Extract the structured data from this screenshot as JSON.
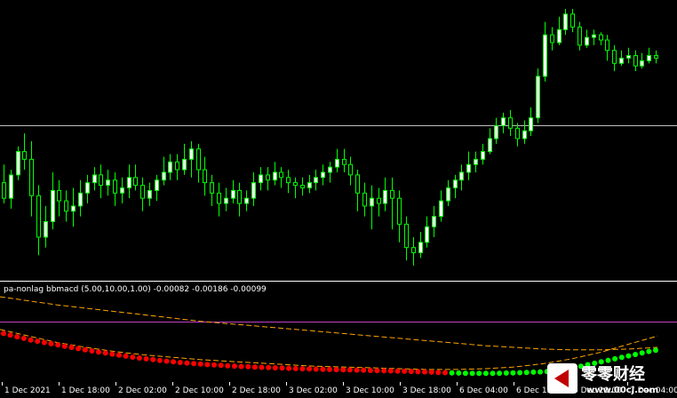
{
  "indicator": {
    "title": "pa-nonlag bbmacd (5.00,10.00,1.00) -0.00082 -0.00186 -0.00099"
  },
  "watermark": {
    "text": "零零财经",
    "url": "www.00cj.com"
  },
  "colors": {
    "background": "#000000",
    "candle_up": "#ffffff",
    "candle_down": "#000000",
    "candle_outline": "#00ff00",
    "hline": "#c0c0c0",
    "separator": "#ffffff",
    "zero_line": "#c040c0",
    "band": "#ffa500",
    "macd_down": "#ff0000",
    "macd_up": "#00ff00"
  },
  "chart_data": [
    {
      "type": "candlestick",
      "horizontal_line": 0.55,
      "ylim": [
        0,
        1
      ],
      "candles": [
        [
          0.33,
          0.27,
          0.4,
          0.25
        ],
        [
          0.27,
          0.36,
          0.38,
          0.23
        ],
        [
          0.36,
          0.45,
          0.47,
          0.34
        ],
        [
          0.45,
          0.42,
          0.52,
          0.38
        ],
        [
          0.42,
          0.28,
          0.49,
          0.2
        ],
        [
          0.28,
          0.12,
          0.32,
          0.05
        ],
        [
          0.12,
          0.18,
          0.24,
          0.08
        ],
        [
          0.18,
          0.3,
          0.37,
          0.15
        ],
        [
          0.3,
          0.26,
          0.34,
          0.2
        ],
        [
          0.26,
          0.22,
          0.3,
          0.18
        ],
        [
          0.22,
          0.24,
          0.31,
          0.16
        ],
        [
          0.24,
          0.29,
          0.34,
          0.2
        ],
        [
          0.29,
          0.33,
          0.36,
          0.25
        ],
        [
          0.33,
          0.36,
          0.39,
          0.3
        ],
        [
          0.36,
          0.32,
          0.4,
          0.27
        ],
        [
          0.32,
          0.34,
          0.38,
          0.28
        ],
        [
          0.34,
          0.29,
          0.37,
          0.24
        ],
        [
          0.29,
          0.31,
          0.35,
          0.25
        ],
        [
          0.31,
          0.35,
          0.4,
          0.27
        ],
        [
          0.35,
          0.32,
          0.4,
          0.3
        ],
        [
          0.32,
          0.27,
          0.35,
          0.22
        ],
        [
          0.27,
          0.3,
          0.33,
          0.24
        ],
        [
          0.3,
          0.34,
          0.36,
          0.26
        ],
        [
          0.34,
          0.37,
          0.43,
          0.32
        ],
        [
          0.37,
          0.41,
          0.44,
          0.34
        ],
        [
          0.41,
          0.38,
          0.44,
          0.34
        ],
        [
          0.38,
          0.42,
          0.48,
          0.36
        ],
        [
          0.42,
          0.46,
          0.49,
          0.35
        ],
        [
          0.46,
          0.38,
          0.48,
          0.33
        ],
        [
          0.38,
          0.33,
          0.43,
          0.28
        ],
        [
          0.33,
          0.29,
          0.36,
          0.24
        ],
        [
          0.29,
          0.25,
          0.33,
          0.2
        ],
        [
          0.25,
          0.27,
          0.31,
          0.22
        ],
        [
          0.27,
          0.3,
          0.34,
          0.25
        ],
        [
          0.3,
          0.25,
          0.33,
          0.2
        ],
        [
          0.25,
          0.27,
          0.3,
          0.22
        ],
        [
          0.27,
          0.33,
          0.37,
          0.24
        ],
        [
          0.33,
          0.36,
          0.39,
          0.3
        ],
        [
          0.36,
          0.34,
          0.39,
          0.3
        ],
        [
          0.34,
          0.37,
          0.41,
          0.32
        ],
        [
          0.37,
          0.35,
          0.39,
          0.31
        ],
        [
          0.35,
          0.33,
          0.38,
          0.29
        ],
        [
          0.33,
          0.32,
          0.35,
          0.27
        ],
        [
          0.32,
          0.31,
          0.35,
          0.28
        ],
        [
          0.31,
          0.33,
          0.36,
          0.29
        ],
        [
          0.33,
          0.35,
          0.38,
          0.3
        ],
        [
          0.35,
          0.37,
          0.4,
          0.32
        ],
        [
          0.37,
          0.39,
          0.41,
          0.33
        ],
        [
          0.39,
          0.42,
          0.46,
          0.37
        ],
        [
          0.42,
          0.4,
          0.46,
          0.37
        ],
        [
          0.4,
          0.36,
          0.43,
          0.32
        ],
        [
          0.36,
          0.29,
          0.38,
          0.22
        ],
        [
          0.29,
          0.24,
          0.33,
          0.2
        ],
        [
          0.24,
          0.27,
          0.32,
          0.15
        ],
        [
          0.27,
          0.25,
          0.31,
          0.2
        ],
        [
          0.25,
          0.3,
          0.35,
          0.22
        ],
        [
          0.3,
          0.27,
          0.35,
          0.15
        ],
        [
          0.27,
          0.17,
          0.3,
          0.1
        ],
        [
          0.17,
          0.08,
          0.2,
          0.03
        ],
        [
          0.08,
          0.06,
          0.12,
          0.01
        ],
        [
          0.06,
          0.1,
          0.14,
          0.04
        ],
        [
          0.1,
          0.16,
          0.2,
          0.08
        ],
        [
          0.16,
          0.2,
          0.24,
          0.12
        ],
        [
          0.2,
          0.26,
          0.3,
          0.18
        ],
        [
          0.26,
          0.31,
          0.34,
          0.24
        ],
        [
          0.31,
          0.34,
          0.36,
          0.27
        ],
        [
          0.34,
          0.37,
          0.4,
          0.3
        ],
        [
          0.37,
          0.4,
          0.45,
          0.34
        ],
        [
          0.4,
          0.42,
          0.45,
          0.37
        ],
        [
          0.42,
          0.45,
          0.48,
          0.4
        ],
        [
          0.45,
          0.5,
          0.54,
          0.44
        ],
        [
          0.5,
          0.55,
          0.58,
          0.48
        ],
        [
          0.55,
          0.58,
          0.6,
          0.52
        ],
        [
          0.58,
          0.54,
          0.61,
          0.51
        ],
        [
          0.54,
          0.5,
          0.56,
          0.47
        ],
        [
          0.5,
          0.53,
          0.57,
          0.48
        ],
        [
          0.53,
          0.58,
          0.62,
          0.51
        ],
        [
          0.58,
          0.74,
          0.77,
          0.56
        ],
        [
          0.74,
          0.9,
          0.95,
          0.72
        ],
        [
          0.9,
          0.87,
          0.93,
          0.84
        ],
        [
          0.87,
          0.92,
          0.97,
          0.86
        ],
        [
          0.92,
          0.98,
          1.0,
          0.9
        ],
        [
          0.98,
          0.93,
          1.0,
          0.91
        ],
        [
          0.93,
          0.86,
          0.95,
          0.84
        ],
        [
          0.86,
          0.89,
          0.92,
          0.85
        ],
        [
          0.89,
          0.9,
          0.92,
          0.86
        ],
        [
          0.9,
          0.88,
          0.91,
          0.86
        ],
        [
          0.88,
          0.84,
          0.9,
          0.8
        ],
        [
          0.84,
          0.79,
          0.86,
          0.76
        ],
        [
          0.79,
          0.81,
          0.84,
          0.78
        ],
        [
          0.81,
          0.82,
          0.85,
          0.79
        ],
        [
          0.82,
          0.78,
          0.84,
          0.76
        ],
        [
          0.78,
          0.8,
          0.83,
          0.77
        ],
        [
          0.8,
          0.82,
          0.85,
          0.79
        ],
        [
          0.82,
          0.81,
          0.84,
          0.79
        ]
      ]
    },
    {
      "type": "line",
      "zero_line": 0.7,
      "ylim": [
        0,
        1
      ],
      "upper_band": [
        1.0,
        0.95,
        0.9,
        0.86,
        0.82,
        0.78,
        0.74,
        0.7,
        0.67,
        0.64,
        0.61,
        0.58,
        0.55,
        0.52,
        0.49,
        0.46,
        0.43,
        0.4,
        0.38,
        0.36,
        0.35,
        0.35,
        0.36,
        0.38
      ],
      "lower_band": [
        0.6,
        0.52,
        0.44,
        0.38,
        0.33,
        0.29,
        0.26,
        0.23,
        0.21,
        0.19,
        0.17,
        0.15,
        0.14,
        0.13,
        0.12,
        0.11,
        0.11,
        0.12,
        0.14,
        0.18,
        0.24,
        0.32,
        0.42,
        0.52
      ],
      "macd": [
        0.55,
        0.53,
        0.51,
        0.49,
        0.47,
        0.455,
        0.44,
        0.425,
        0.41,
        0.395,
        0.38,
        0.365,
        0.35,
        0.337,
        0.324,
        0.311,
        0.298,
        0.285,
        0.273,
        0.261,
        0.25,
        0.24,
        0.23,
        0.221,
        0.212,
        0.204,
        0.196,
        0.189,
        0.182,
        0.176,
        0.17,
        0.165,
        0.16,
        0.155,
        0.151,
        0.147,
        0.143,
        0.139,
        0.136,
        0.133,
        0.13,
        0.127,
        0.124,
        0.121,
        0.118,
        0.116,
        0.114,
        0.112,
        0.11,
        0.108,
        0.106,
        0.104,
        0.102,
        0.1,
        0.098,
        0.096,
        0.094,
        0.092,
        0.09,
        0.088,
        0.086,
        0.083,
        0.08,
        0.077,
        0.074,
        0.071,
        0.068,
        0.066,
        0.064,
        0.063,
        0.062,
        0.062,
        0.063,
        0.064,
        0.066,
        0.068,
        0.071,
        0.074,
        0.077,
        0.08,
        0.084,
        0.09,
        0.1,
        0.115,
        0.132,
        0.15,
        0.168,
        0.186,
        0.204,
        0.222,
        0.24,
        0.258,
        0.276,
        0.294,
        0.312,
        0.33,
        0.345
      ],
      "macd_up_from_index": 66
    }
  ],
  "x_axis": {
    "labels": [
      "1 Dec 2021",
      "1 Dec 18:00",
      "2 Dec 02:00",
      "2 Dec 10:00",
      "2 Dec 18:00",
      "3 Dec 02:00",
      "3 Dec 10:00",
      "3 Dec 18:00",
      "6 Dec 04:00",
      "6 Dec 12:00",
      "6 Dec 20:00",
      "7 Dec 04:00"
    ]
  }
}
